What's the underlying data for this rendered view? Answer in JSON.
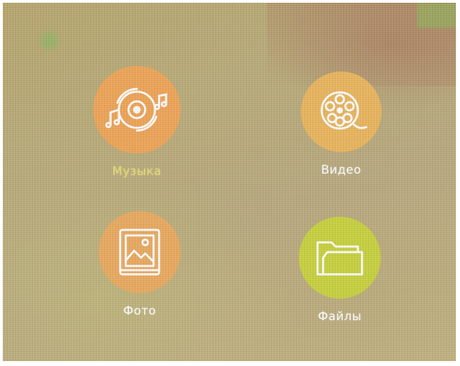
{
  "menu": {
    "items": [
      {
        "id": "music",
        "label": "Музыка",
        "icon": "music-disc-icon",
        "circle_color": "#f0a454",
        "label_color": "#e6e05c"
      },
      {
        "id": "video",
        "label": "Видео",
        "icon": "film-reel-icon",
        "circle_color": "#ebb55a",
        "label_color": "#ffffff"
      },
      {
        "id": "photo",
        "label": "Фото",
        "icon": "photo-picture-icon",
        "circle_color": "#eba95c",
        "label_color": "#ffffff"
      },
      {
        "id": "files",
        "label": "Файлы",
        "icon": "folder-icon",
        "circle_color": "#c8d23a",
        "label_color": "#ffffff"
      }
    ]
  },
  "colors": {
    "icon_stroke": "#ffffff"
  }
}
